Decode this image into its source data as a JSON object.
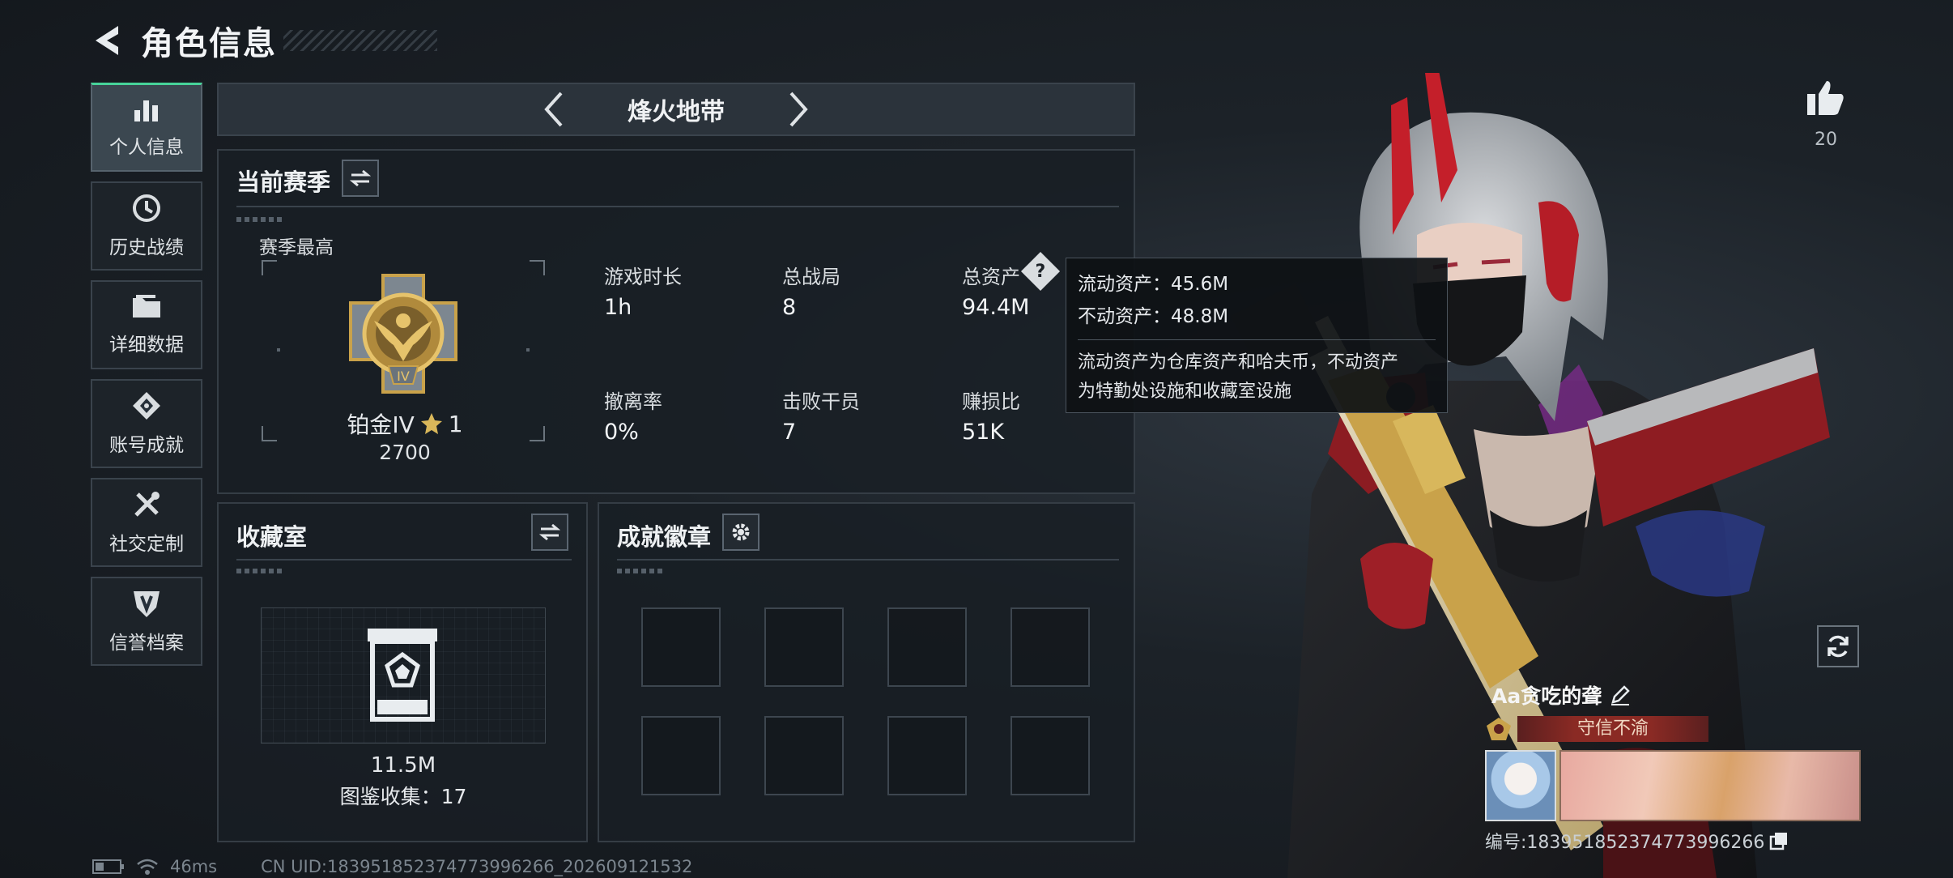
{
  "header": {
    "title": "角色信息"
  },
  "sidebar": {
    "items": [
      {
        "label": "个人信息",
        "icon": "bar-chart-icon",
        "active": true
      },
      {
        "label": "历史战绩",
        "icon": "history-clock-icon"
      },
      {
        "label": "详细数据",
        "icon": "folder-icon"
      },
      {
        "label": "账号成就",
        "icon": "achievement-icon"
      },
      {
        "label": "社交定制",
        "icon": "tools-icon"
      },
      {
        "label": "信誉档案",
        "icon": "reputation-shield-icon"
      }
    ]
  },
  "mode": {
    "label": "烽火地带"
  },
  "season": {
    "title": "当前赛季",
    "highest_label": "赛季最高",
    "rank_name": "铂金IV",
    "rank_stars": "1",
    "rank_points": "2700",
    "stats": [
      {
        "label": "游戏时长",
        "value": "1h"
      },
      {
        "label": "总战局",
        "value": "8"
      },
      {
        "label": "总资产",
        "value": "94.4M"
      },
      {
        "label": "撤离率",
        "value": "0%"
      },
      {
        "label": "击败干员",
        "value": "7"
      },
      {
        "label": "赚损比",
        "value": "51K"
      }
    ]
  },
  "tooltip": {
    "liquid": "流动资产：45.6M",
    "fixed": "不动资产：48.8M",
    "desc_line1": "流动资产为仓库资产和哈夫币，不动资产",
    "desc_line2": "为特勤处设施和收藏室设施",
    "help_icon": "?"
  },
  "collection": {
    "title": "收藏室",
    "value": "11.5M",
    "catalog": "图鉴收集：17"
  },
  "badges": {
    "title": "成就徽章",
    "slots": 8
  },
  "likes": {
    "count": "20"
  },
  "player": {
    "nickname": "Aa贪吃的聋",
    "title": "守信不渝",
    "id_text": "编号:1839518523747739962​66"
  },
  "status": {
    "ping": "46ms",
    "uid": "CN UID:1839518523747739962​66_202609121532"
  },
  "colors": {
    "accent_green": "#47d49a",
    "title_red": "#8a2a24",
    "gold": "#c9a24a"
  }
}
